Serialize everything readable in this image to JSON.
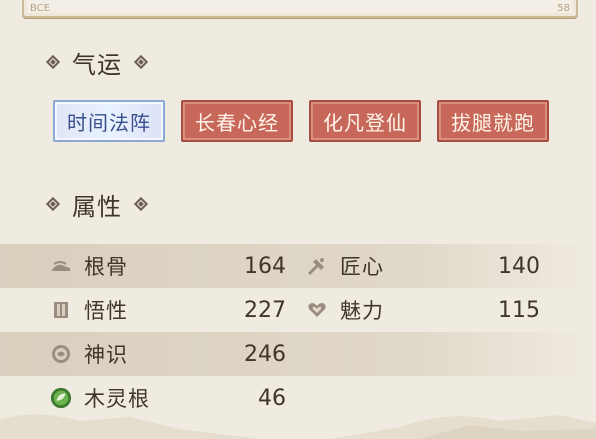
{
  "top_panel": {
    "left_fragment": "BCE",
    "right_fragment": "58"
  },
  "fortune": {
    "title": "气运",
    "tags": [
      {
        "label": "时间法阵",
        "style": "blue"
      },
      {
        "label": "长春心经",
        "style": "red"
      },
      {
        "label": "化凡登仙",
        "style": "red"
      },
      {
        "label": "拔腿就跑",
        "style": "red"
      }
    ]
  },
  "attributes": {
    "title": "属性",
    "rows": [
      {
        "left": {
          "label": "根骨",
          "value": "164",
          "icon": "bone-icon"
        },
        "right": {
          "label": "匠心",
          "value": "140",
          "icon": "hammer-icon"
        }
      },
      {
        "left": {
          "label": "悟性",
          "value": "227",
          "icon": "book-icon"
        },
        "right": {
          "label": "魅力",
          "value": "115",
          "icon": "heart-icon"
        }
      },
      {
        "left": {
          "label": "神识",
          "value": "246",
          "icon": "spirit-sense-icon"
        }
      },
      {
        "left": {
          "label": "木灵根",
          "value": "46",
          "icon": "wood-root-icon"
        }
      }
    ]
  },
  "colors": {
    "background": "#f0ebe1",
    "tag_red": "#c8685a",
    "tag_blue_text": "#3a4f8e",
    "wood_green": "#4f9a3e"
  }
}
